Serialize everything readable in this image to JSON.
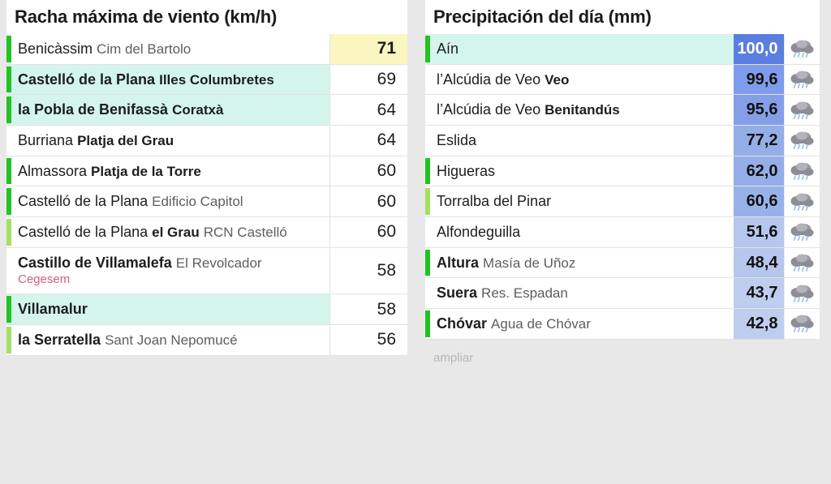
{
  "page": {
    "background": "#e8e8e8",
    "highlight_row_color": "#d4f5ec",
    "top_value_color": "#fbf5bf",
    "accent_green_strong": "#22c322",
    "accent_green_light": "#a3e063"
  },
  "wind_panel": {
    "title": "Racha máxima de viento (km/h)",
    "rows": [
      {
        "muni": "Benicàssim",
        "muni_bold": false,
        "spot": "Cim del Bartolo",
        "spot_bold": false,
        "net": "",
        "value": "71",
        "accent": "#22c322",
        "highlight": false,
        "top": true
      },
      {
        "muni": "Castelló de la Plana",
        "muni_bold": true,
        "spot": "Illes Columbretes",
        "spot_bold": true,
        "net": "",
        "value": "69",
        "accent": "#22c322",
        "highlight": true,
        "top": false
      },
      {
        "muni": "la Pobla de Benifassà",
        "muni_bold": true,
        "spot": "Coratxà",
        "spot_bold": true,
        "net": "",
        "value": "64",
        "accent": "#22c322",
        "highlight": true,
        "top": false
      },
      {
        "muni": "Burriana",
        "muni_bold": false,
        "spot": "Platja del Grau",
        "spot_bold": true,
        "net": "",
        "value": "64",
        "accent": "",
        "highlight": false,
        "top": false
      },
      {
        "muni": "Almassora",
        "muni_bold": false,
        "spot": "Platja de la Torre",
        "spot_bold": true,
        "net": "",
        "value": "60",
        "accent": "#22c322",
        "highlight": false,
        "top": false
      },
      {
        "muni": "Castelló de la Plana",
        "muni_bold": false,
        "spot": "Edificio Capitol",
        "spot_bold": false,
        "net": "",
        "value": "60",
        "accent": "#22c322",
        "highlight": false,
        "top": false
      },
      {
        "muni": "Castelló de la Plana",
        "muni_bold": false,
        "spot": "el Grau",
        "spot_bold": true,
        "spot2": "RCN Castelló",
        "net": "",
        "value": "60",
        "accent": "#a3e063",
        "highlight": false,
        "top": false
      },
      {
        "muni": "Castillo de Villamalefa",
        "muni_bold": true,
        "spot": "El Revolcador",
        "spot_bold": false,
        "net": "Cegesem",
        "value": "58",
        "accent": "",
        "highlight": false,
        "top": false
      },
      {
        "muni": "Villamalur",
        "muni_bold": true,
        "spot": "",
        "spot_bold": false,
        "net": "",
        "value": "58",
        "accent": "#22c322",
        "highlight": true,
        "top": false
      },
      {
        "muni": "la Serratella",
        "muni_bold": true,
        "spot": "Sant Joan Nepomucé",
        "spot_bold": false,
        "net": "",
        "value": "56",
        "accent": "#a3e063",
        "highlight": false,
        "top": false
      }
    ]
  },
  "rain_panel": {
    "title": "Precipitación del día (mm)",
    "expand_label": "ampliar",
    "icon_name": "rain-cloud-icon",
    "rows": [
      {
        "muni": "Aín",
        "muni_bold": false,
        "spot": "",
        "spot_bold": false,
        "value": "100,0",
        "cell_color": "#5b7fe0",
        "accent": "#22c322",
        "highlight": true,
        "top": true
      },
      {
        "muni": "l’Alcúdia de Veo",
        "muni_bold": false,
        "spot": "Veo",
        "spot_bold": true,
        "value": "99,6",
        "cell_color": "#7d9cec",
        "accent": "",
        "highlight": false,
        "top": false
      },
      {
        "muni": "l’Alcúdia de Veo",
        "muni_bold": false,
        "spot": "Benitandús",
        "spot_bold": true,
        "value": "95,6",
        "cell_color": "#849fe8",
        "accent": "",
        "highlight": false,
        "top": false
      },
      {
        "muni": "Eslida",
        "muni_bold": false,
        "spot": "",
        "spot_bold": false,
        "value": "77,2",
        "cell_color": "#94aee8",
        "accent": "",
        "highlight": false,
        "top": false
      },
      {
        "muni": "Higueras",
        "muni_bold": false,
        "spot": "",
        "spot_bold": false,
        "value": "62,0",
        "cell_color": "#94aee8",
        "accent": "#22c322",
        "highlight": false,
        "top": false
      },
      {
        "muni": "Torralba del Pinar",
        "muni_bold": false,
        "spot": "",
        "spot_bold": false,
        "value": "60,6",
        "cell_color": "#97b1e9",
        "accent": "#a3e063",
        "highlight": false,
        "top": false
      },
      {
        "muni": "Alfondeguilla",
        "muni_bold": false,
        "spot": "",
        "spot_bold": false,
        "value": "51,6",
        "cell_color": "#b6c6ec",
        "accent": "",
        "highlight": false,
        "top": false
      },
      {
        "muni": "Altura",
        "muni_bold": true,
        "spot": "Masía de Uñoz",
        "spot_bold": false,
        "value": "48,4",
        "cell_color": "#b6c6ec",
        "accent": "#22c322",
        "highlight": false,
        "top": false
      },
      {
        "muni": "Suera",
        "muni_bold": true,
        "spot": "Res. Espadan",
        "spot_bold": false,
        "value": "43,7",
        "cell_color": "#bfcdee",
        "accent": "",
        "highlight": false,
        "top": false
      },
      {
        "muni": "Chóvar",
        "muni_bold": true,
        "spot": "Agua de Chóvar",
        "spot_bold": false,
        "value": "42,8",
        "cell_color": "#bfcdee",
        "accent": "#22c322",
        "highlight": false,
        "top": false
      }
    ]
  }
}
